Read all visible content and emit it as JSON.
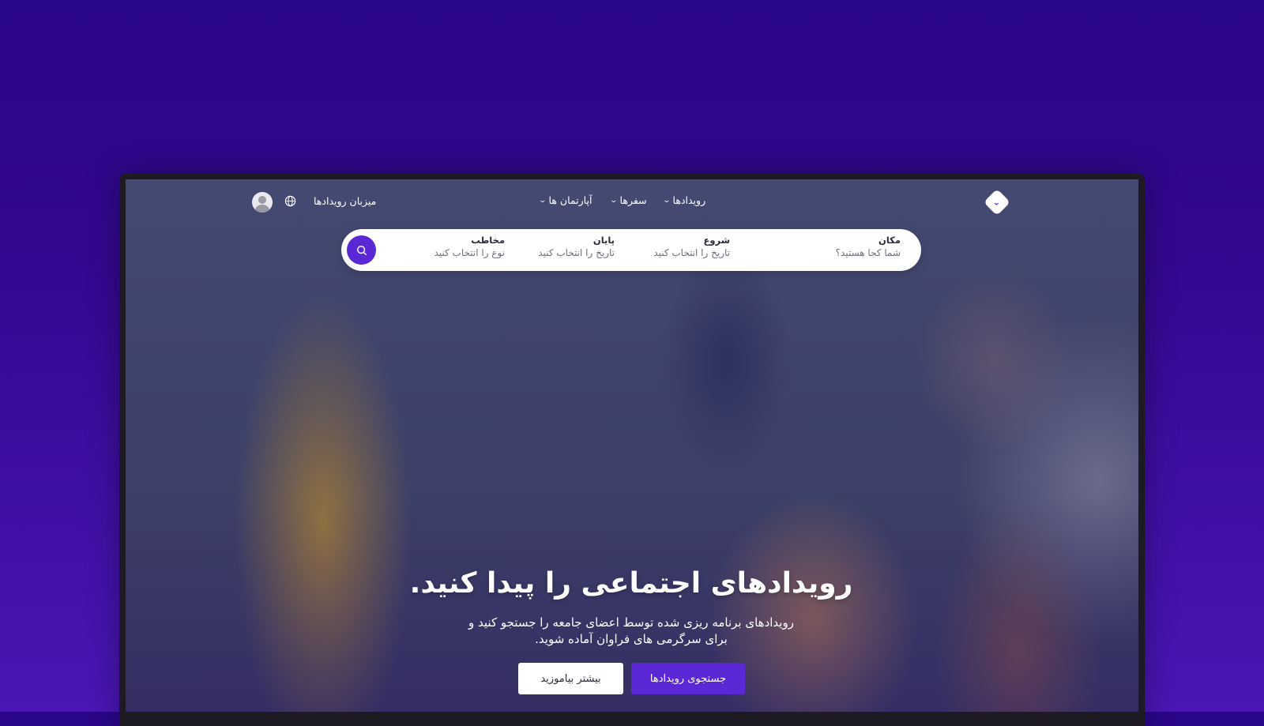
{
  "header": {
    "nav": [
      {
        "label": "رویدادها"
      },
      {
        "label": "سفرها"
      },
      {
        "label": "آپارتمان ها"
      }
    ],
    "host_link": "میزبان رویدادها",
    "icons": {
      "logo": "diamond-logo-icon",
      "language": "globe-icon",
      "account": "user-avatar-icon",
      "dropdown": "chevron-down-icon"
    }
  },
  "search": {
    "fields": [
      {
        "label": "مکان",
        "value": "شما کجا هستید؟"
      },
      {
        "label": "شروع",
        "value": "تاریخ را انتخاب کنید"
      },
      {
        "label": "پایان",
        "value": "تاریخ را انتخاب کنید"
      },
      {
        "label": "مخاطب",
        "value": "نوع را انتخاب کنید"
      }
    ],
    "button_icon": "search-icon"
  },
  "hero": {
    "title": "رویدادهای اجتماعی را پیدا کنید.",
    "subtitle_line1": "رویدادهای برنامه ریزی شده توسط اعضای جامعه را جستجو کنید و",
    "subtitle_line2": "برای سرگرمی های فراوان آماده شوید.",
    "primary_button": "جستجوی رویدادها",
    "secondary_button": "بیشتر بیاموزید"
  },
  "colors": {
    "accent": "#5b28d6",
    "background": "#2a0688"
  }
}
